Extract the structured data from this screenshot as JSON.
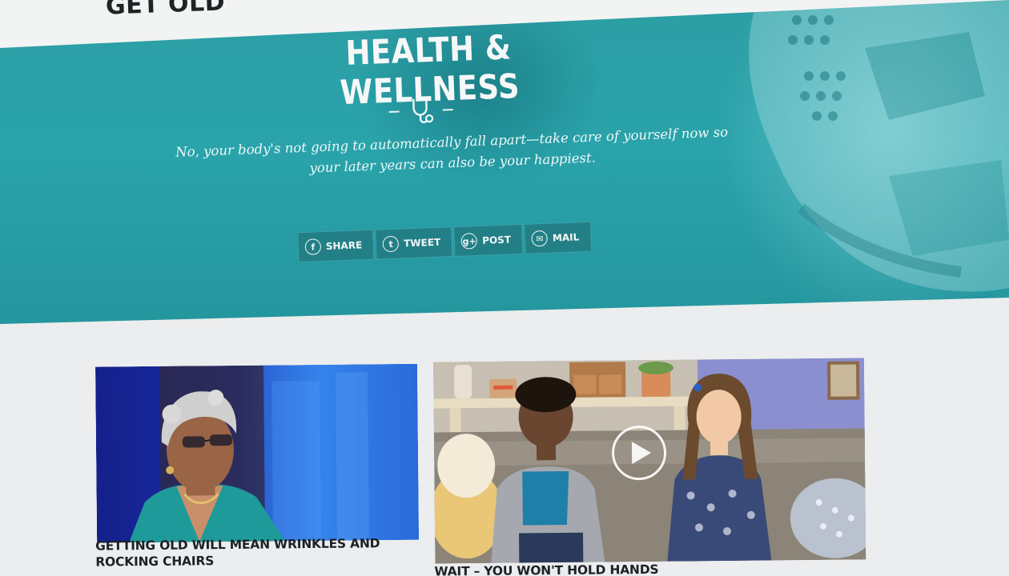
{
  "header": {
    "logo_text": "GET OLD"
  },
  "hero": {
    "title": "HEALTH & WELLNESS",
    "divider_icon": "stethoscope-icon",
    "subtitle": "No, your body's not going to automatically fall apart—take care of yourself now so your later years can also be your happiest.",
    "share_buttons": [
      {
        "icon": "facebook-icon",
        "glyph": "f",
        "label": "SHARE"
      },
      {
        "icon": "twitter-icon",
        "glyph": "t",
        "label": "TWEET"
      },
      {
        "icon": "google-plus-icon",
        "glyph": "g+",
        "label": "POST"
      },
      {
        "icon": "mail-icon",
        "glyph": "✉",
        "label": "MAIL"
      }
    ],
    "colors": {
      "teal": "#2aa3ab",
      "button": "#237f86"
    }
  },
  "articles": [
    {
      "title": "GETTING OLD WILL MEAN WRINKLES AND ROCKING CHAIRS",
      "media": "interview-photo"
    },
    {
      "title": "WAIT – YOU WON'T HOLD HANDS",
      "media": "video-thumbnail",
      "play_icon": "play-icon"
    }
  ]
}
